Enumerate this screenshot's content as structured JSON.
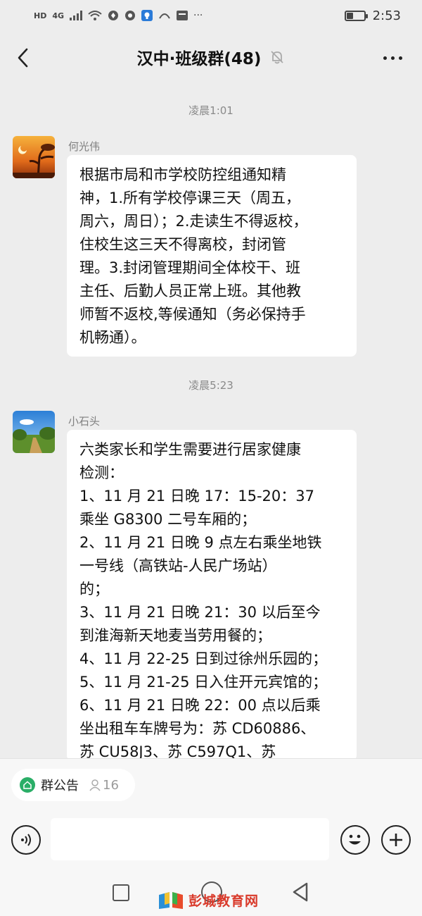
{
  "status_bar": {
    "network_labels": [
      "HD",
      "4G"
    ],
    "time": "2:53",
    "battery_level": 0.35
  },
  "header": {
    "title": "汉中·班级群(48)",
    "back_icon": "chevron-left-icon",
    "mute_icon": "bell-muted-icon",
    "more_icon": "more-dots-icon"
  },
  "messages": [
    {
      "time": "凌晨1:01",
      "sender": "何光伟",
      "avatar": "sunset-landscape",
      "lines": [
        "根据市局和市学校防控组通知精",
        "神，1.所有学校停课三天（周五，",
        "周六，周日）；2.走读生不得返校，",
        "住校生这三天不得离校，封闭管",
        "理。3.封闭管理期间全体校干、班",
        "主任、后勤人员正常上班。其他教",
        "师暂不返校,等候通知（务必保持手",
        "机畅通）。"
      ]
    },
    {
      "time": "凌晨5:23",
      "sender": "小石头",
      "avatar": "country-road-landscape",
      "lines": [
        "六类家长和学生需要进行居家健康",
        "检测：",
        "1、11 月 21 日晚 17：15-20：37",
        "乘坐 G8300 二号车厢的；",
        "2、11 月 21 日晚 9 点左右乘坐地铁",
        "一号线（高铁站-人民广场站）",
        "的；",
        "3、11 月 21 日晚 21：30 以后至今",
        "到淮海新天地麦当劳用餐的；",
        "4、11 月 22-25 日到过徐州乐园的；",
        "5、11 月 21-25 日入住开元宾馆的；",
        "6、11 月 21 日晚 22：00 点以后乘",
        "坐出租车车牌号为：苏 CD60886、",
        "苏 CU58J3、苏 C597Q1、苏"
      ]
    }
  ],
  "bottom": {
    "notice_label": "群公告",
    "member_count": "16",
    "input_placeholder": ""
  },
  "watermark": {
    "text": "彭城教育网"
  },
  "colors": {
    "background": "#ededed",
    "bubble": "#ffffff",
    "notice_green": "#2aae67",
    "watermark_red": "#d93a2b"
  }
}
